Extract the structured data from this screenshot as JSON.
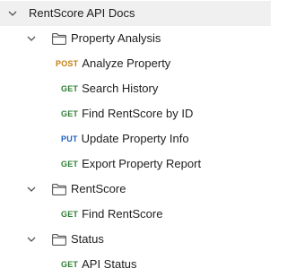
{
  "collection": {
    "title": "RentScore API Docs",
    "folders": [
      {
        "name": "Property Analysis",
        "requests": [
          {
            "method": "POST",
            "name": "Analyze Property"
          },
          {
            "method": "GET",
            "name": "Search History"
          },
          {
            "method": "GET",
            "name": "Find RentScore by ID"
          },
          {
            "method": "PUT",
            "name": "Update Property Info"
          },
          {
            "method": "GET",
            "name": "Export Property Report"
          }
        ]
      },
      {
        "name": "RentScore",
        "requests": [
          {
            "method": "GET",
            "name": "Find RentScore"
          }
        ]
      },
      {
        "name": "Status",
        "requests": [
          {
            "method": "GET",
            "name": "API Status"
          }
        ]
      }
    ]
  },
  "method_colors": {
    "POST": "#c47d0e",
    "GET": "#2e7d32",
    "PUT": "#1d5fbf"
  },
  "icons": {
    "expanded": "chevron-down-icon",
    "folder": "folder-icon"
  }
}
